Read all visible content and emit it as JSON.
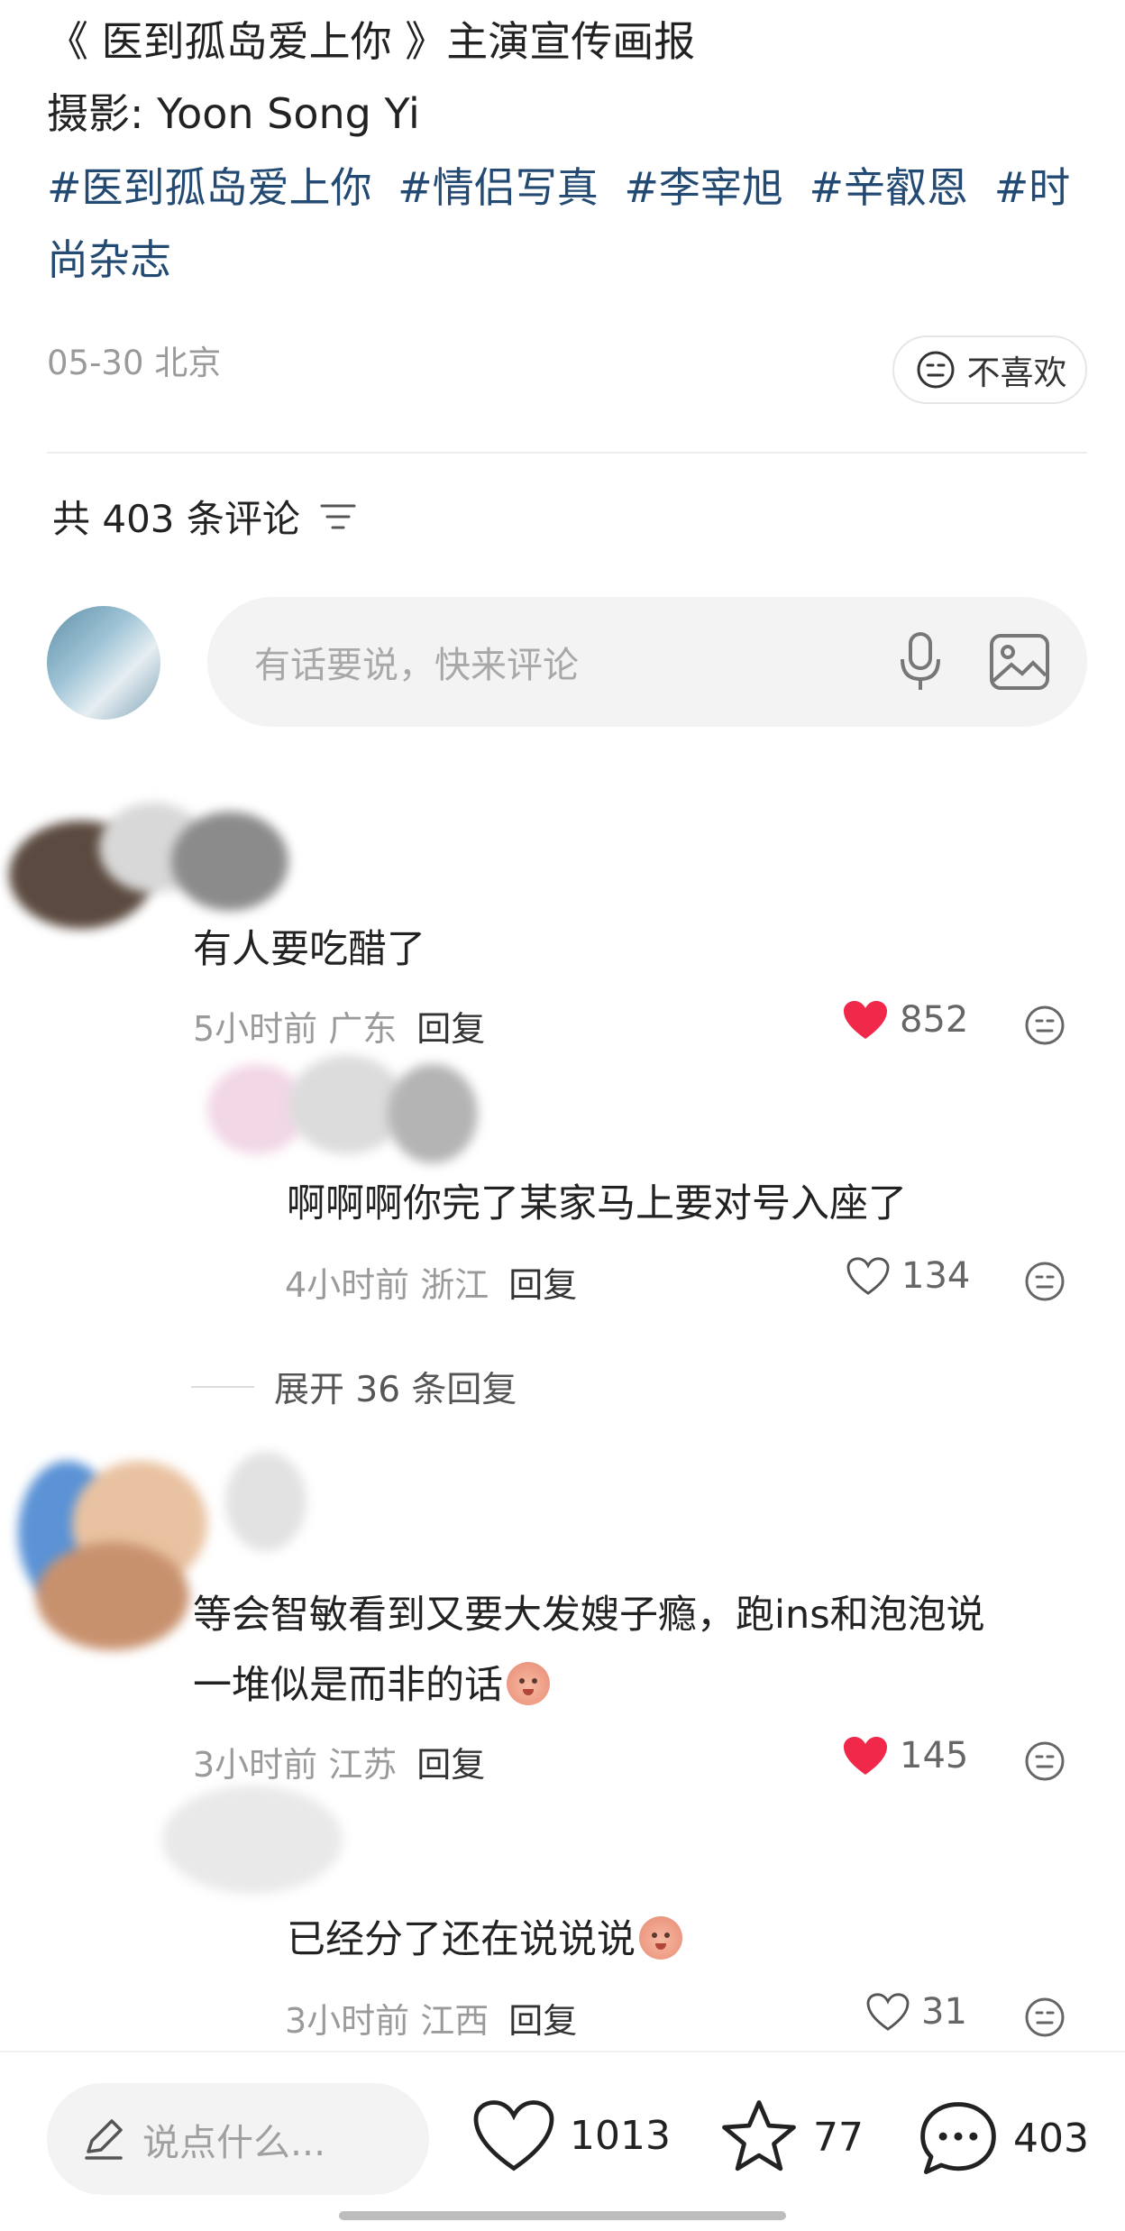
{
  "post": {
    "title": "《 医到孤岛爱上你 》主演宣传画报",
    "photographer": "摄影: Yoon Song Yi",
    "tags": [
      "#医到孤岛爱上你",
      "#情侣写真",
      "#李宰旭",
      "#辛叡恩",
      "#时尚杂志"
    ],
    "date_location": "05-30 北京",
    "dislike_label": "不喜欢"
  },
  "comments_header": {
    "count_label": "共 403 条评论"
  },
  "comment_input": {
    "placeholder": "有话要说，快来评论"
  },
  "comments": [
    {
      "text": "有人要吃醋了",
      "time_location": "5小时前 广东",
      "reply_label": "回复",
      "likes": "852",
      "liked": true,
      "replies": [
        {
          "text": "啊啊啊你完了某家马上要对号入座了",
          "time_location": "4小时前 浙江",
          "reply_label": "回复",
          "likes": "134",
          "liked": false
        }
      ],
      "expand_label": "展开 36 条回复"
    },
    {
      "text_line1": "等会智敏看到又要大发嫂子瘾，跑ins和泡泡说",
      "text_line2": "一堆似是而非的话",
      "time_location": "3小时前 江苏",
      "reply_label": "回复",
      "likes": "145",
      "liked": true,
      "replies": [
        {
          "text": "已经分了还在说说说",
          "time_location": "3小时前 江西",
          "reply_label": "回复",
          "likes": "31",
          "liked": false
        }
      ]
    }
  ],
  "bottom_bar": {
    "say_placeholder": "说点什么...",
    "likes": "1013",
    "favorites": "77",
    "comments": "403"
  },
  "colors": {
    "tag_blue": "#234a73",
    "like_red": "#f0284a"
  }
}
